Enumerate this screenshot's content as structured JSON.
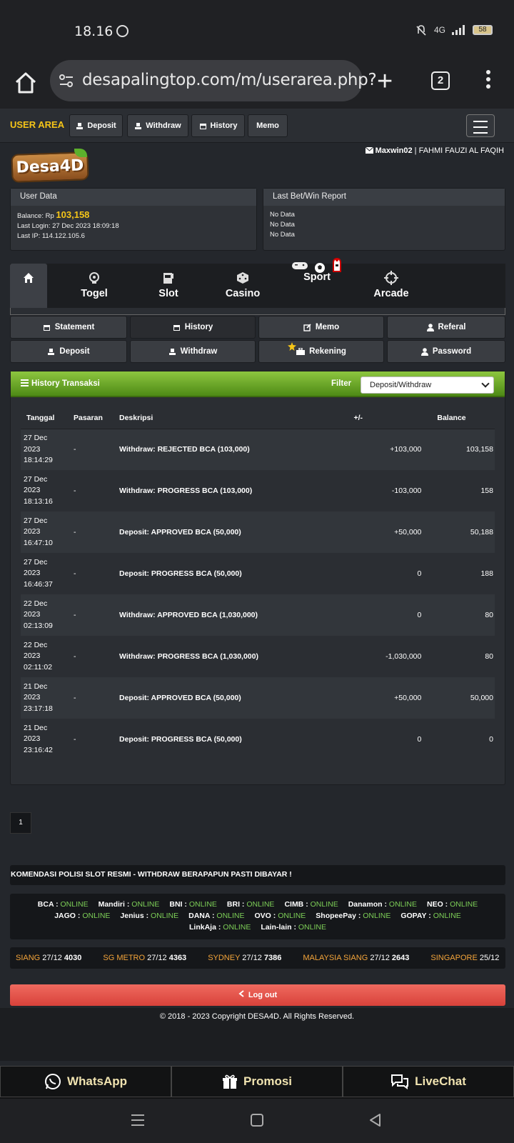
{
  "status_bar": {
    "time": "18.16",
    "signal": "4G",
    "battery": "58"
  },
  "browser": {
    "url": "desapalingtop.com/m/userarea.php?",
    "tab_count": "2"
  },
  "site_nav": {
    "title": "USER AREA",
    "buttons": [
      {
        "label": "Deposit",
        "icon": "deposit-icon"
      },
      {
        "label": "Withdraw",
        "icon": "withdraw-icon"
      },
      {
        "label": "History",
        "icon": "calendar-icon"
      },
      {
        "label": "Memo"
      }
    ]
  },
  "logo": {
    "text": "Desa4D"
  },
  "user": {
    "username": "Maxwin02",
    "separator": " | ",
    "fullname": "FAHMI FAUZI AL FAQIH"
  },
  "user_data": {
    "title": "User Data",
    "balance_label": "Balance: Rp",
    "balance_value": "103,158",
    "last_login": "Last Login: 27 Dec 2023 18:09:18",
    "last_ip": "Last IP: 114.122.105.6"
  },
  "report": {
    "title": "Last Bet/Win Report",
    "lines": [
      "No Data",
      "No Data",
      "No Data"
    ]
  },
  "game_tabs": [
    {
      "label": "",
      "icon": "home-icon"
    },
    {
      "label": "Togel",
      "icon": "lottery-ball-icon"
    },
    {
      "label": "Slot",
      "icon": "slot-machine-icon"
    },
    {
      "label": "Casino",
      "icon": "dice-icon"
    },
    {
      "label": "Sport",
      "icon": "soccer-ball-icon"
    },
    {
      "label": "Arcade",
      "icon": "crosshair-icon"
    }
  ],
  "sub_menu": [
    {
      "label": "Statement",
      "icon": "calendar-icon"
    },
    {
      "label": "History",
      "icon": "calendar-icon"
    },
    {
      "label": "Memo",
      "icon": "edit-icon"
    },
    {
      "label": "Referal",
      "icon": "user-icon"
    },
    {
      "label": "Deposit",
      "icon": "deposit-icon"
    },
    {
      "label": "Withdraw",
      "icon": "withdraw-icon"
    },
    {
      "label": "Rekening",
      "icon": "briefcase-icon"
    },
    {
      "label": "Password",
      "icon": "user-icon"
    }
  ],
  "history": {
    "title": "History Transaksi",
    "filter_label": "Filter",
    "filter_value": "Deposit/Withdraw",
    "columns": [
      "Tanggal",
      "Pasaran",
      "Deskripsi",
      "+/-",
      "Balance"
    ],
    "rows": [
      {
        "date": "27 Dec",
        "year": "2023",
        "time": "18:14:29",
        "pasaran": "-",
        "desc": "Withdraw: REJECTED BCA (103,000)",
        "amount": "+103,000",
        "sign": "pos",
        "balance": "103,158"
      },
      {
        "date": "27 Dec",
        "year": "2023",
        "time": "18:13:16",
        "pasaran": "-",
        "desc": "Withdraw: PROGRESS BCA (103,000)",
        "amount": "-103,000",
        "sign": "neg",
        "balance": "158"
      },
      {
        "date": "27 Dec",
        "year": "2023",
        "time": "16:47:10",
        "pasaran": "-",
        "desc": "Deposit: APPROVED BCA (50,000)",
        "amount": "+50,000",
        "sign": "pos",
        "balance": "50,188"
      },
      {
        "date": "27 Dec",
        "year": "2023",
        "time": "16:46:37",
        "pasaran": "-",
        "desc": "Deposit: PROGRESS BCA (50,000)",
        "amount": "0",
        "sign": "zero",
        "balance": "188"
      },
      {
        "date": "22 Dec",
        "year": "2023",
        "time": "02:13:09",
        "pasaran": "-",
        "desc": "Withdraw: APPROVED BCA (1,030,000)",
        "amount": "0",
        "sign": "zero",
        "balance": "80"
      },
      {
        "date": "22 Dec",
        "year": "2023",
        "time": "02:11:02",
        "pasaran": "-",
        "desc": "Withdraw: PROGRESS BCA (1,030,000)",
        "amount": "-1,030,000",
        "sign": "neg",
        "balance": "80"
      },
      {
        "date": "21 Dec",
        "year": "2023",
        "time": "23:17:18",
        "pasaran": "-",
        "desc": "Deposit: APPROVED BCA (50,000)",
        "amount": "+50,000",
        "sign": "pos",
        "balance": "50,000"
      },
      {
        "date": "21 Dec",
        "year": "2023",
        "time": "23:16:42",
        "pasaran": "-",
        "desc": "Deposit: PROGRESS BCA (50,000)",
        "amount": "0",
        "sign": "zero",
        "balance": "0"
      }
    ]
  },
  "pagination": {
    "current": "1"
  },
  "ticker": "KOMENDASI POLISI SLOT RESMI - WITHDRAW BERAPAPUN PASTI DIBAYAR !",
  "banks": [
    {
      "name": "BCA",
      "status": "ONLINE"
    },
    {
      "name": "Mandiri",
      "status": "ONLINE"
    },
    {
      "name": "BNI",
      "status": "ONLINE"
    },
    {
      "name": "BRI",
      "status": "ONLINE"
    },
    {
      "name": "CIMB",
      "status": "ONLINE"
    },
    {
      "name": "Danamon",
      "status": "ONLINE"
    },
    {
      "name": "NEO",
      "status": "ONLINE"
    },
    {
      "name": "JAGO",
      "status": "ONLINE"
    },
    {
      "name": "Jenius",
      "status": "ONLINE"
    },
    {
      "name": "DANA",
      "status": "ONLINE"
    },
    {
      "name": "OVO",
      "status": "ONLINE"
    },
    {
      "name": "ShopeePay",
      "status": "ONLINE"
    },
    {
      "name": "GOPAY",
      "status": "ONLINE"
    },
    {
      "name": "LinkAja",
      "status": "ONLINE"
    },
    {
      "name": "Lain-lain",
      "status": "ONLINE"
    }
  ],
  "results": [
    {
      "market": "SIANG",
      "date": "27/12",
      "number": "4030"
    },
    {
      "market": "SG METRO",
      "date": "27/12",
      "number": "4363"
    },
    {
      "market": "SYDNEY",
      "date": "27/12",
      "number": "7386"
    },
    {
      "market": "MALAYSIA SIANG",
      "date": "27/12",
      "number": "2643"
    },
    {
      "market": "SINGAPORE",
      "date": "25/12",
      "number": ""
    }
  ],
  "logout_label": "Log out",
  "copyright": "© 2018 - 2023 Copyright DESA4D. All Rights Reserved.",
  "contact_bar": [
    {
      "label": "WhatsApp",
      "icon": "whatsapp-icon"
    },
    {
      "label": "Promosi",
      "icon": "gift-icon"
    },
    {
      "label": "LiveChat",
      "icon": "chat-icon"
    }
  ],
  "colors": {
    "accent": "#f5c518",
    "online": "#7dcf57",
    "positive": "#6cb6e8",
    "negative": "#e2534b",
    "balance": "#f3a43a",
    "header_green": "#6faa2a",
    "logout": "#e2534b"
  }
}
